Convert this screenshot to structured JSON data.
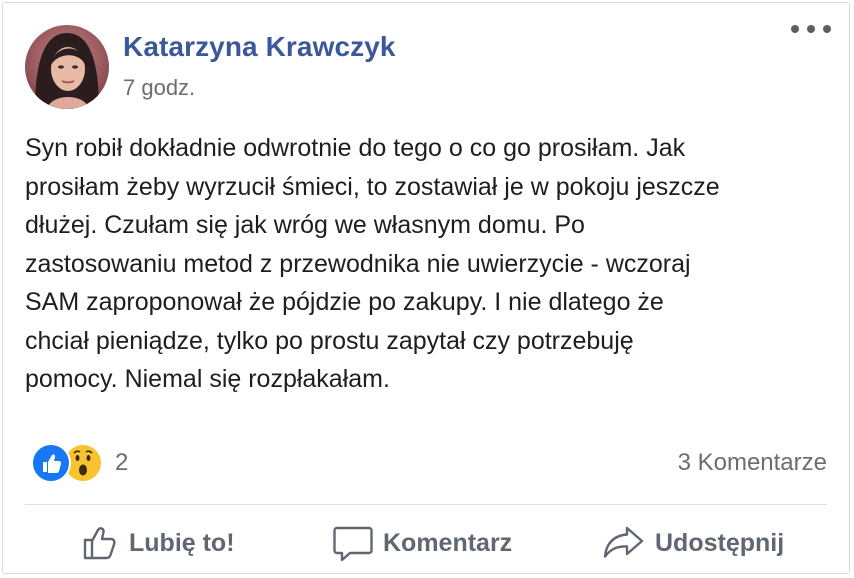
{
  "post": {
    "author": "Katarzyna Krawczyk",
    "time": "7 godz.",
    "text_lines": [
      "Syn robił dokładnie odwrotnie do tego o co go prosiłam. Jak",
      "prosiłam żeby wyrzucił śmieci, to zostawiał je w pokoju jeszcze",
      "dłużej. Czułam się jak wróg we własnym domu. Po",
      "zastosowaniu metod z przewodnika nie uwierzycie - wczoraj",
      "SAM zaproponował że pójdzie po zakupy. I nie dlatego że",
      "chciał pieniądze, tylko po prostu zapytał czy potrzebuję",
      "pomocy. Niemal się rozpłakałam."
    ]
  },
  "reactions": {
    "icons": [
      "like-icon",
      "wow-icon"
    ],
    "count": "2",
    "comments": "3 Komentarze"
  },
  "actions": {
    "like": "Lubię to!",
    "comment": "Komentarz",
    "share": "Udostępnij"
  },
  "colors": {
    "author": "#3b5998",
    "like_blue": "#1877f2",
    "wow_yellow": "#f7c430",
    "muted": "#6d6d6d"
  }
}
